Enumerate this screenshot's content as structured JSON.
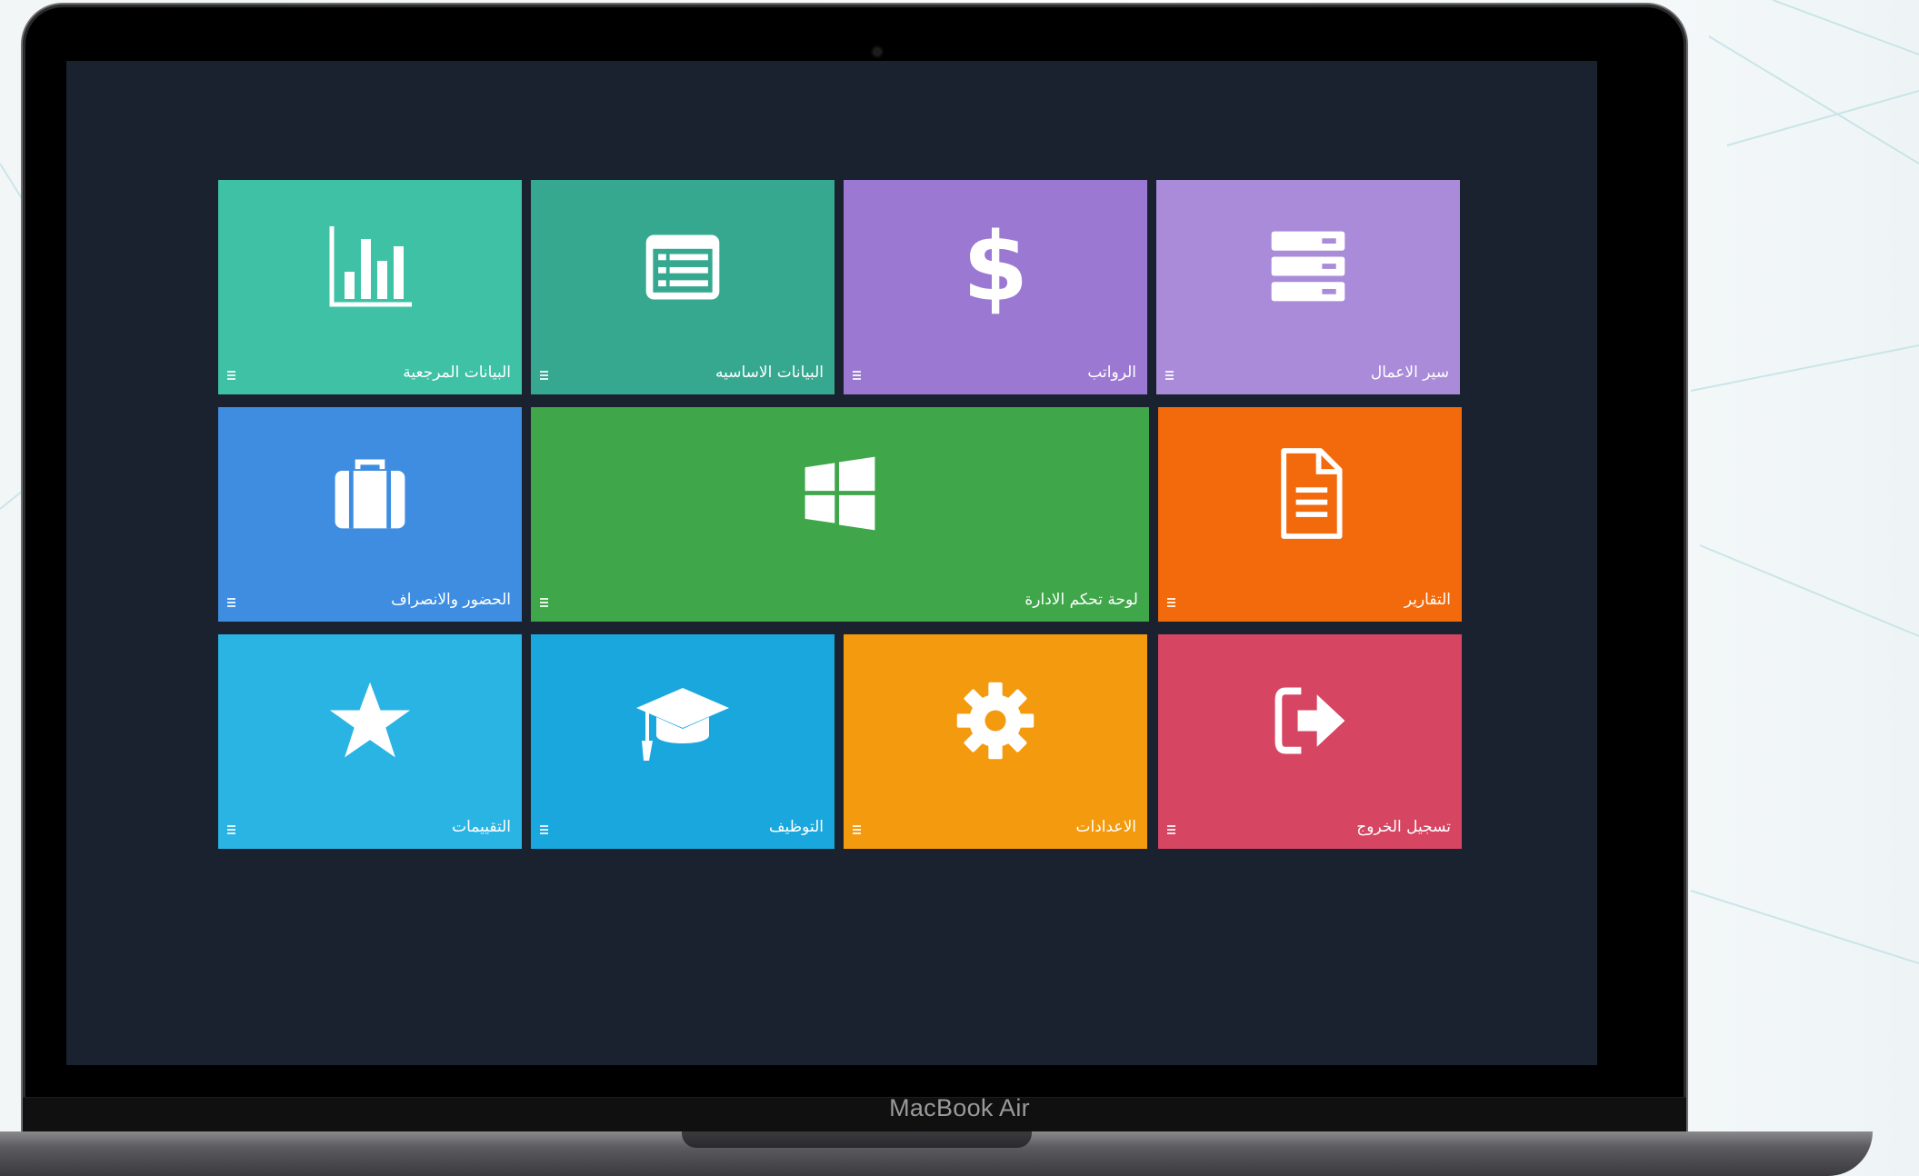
{
  "device": {
    "model_label": "MacBook Air"
  },
  "tiles": [
    {
      "id": "reference-data",
      "label": "البيانات المرجعية",
      "icon": "bar-chart-icon",
      "color": "#3ec1a5"
    },
    {
      "id": "basic-data",
      "label": "البيانات الاساسيه",
      "icon": "list-table-icon",
      "color": "#36a88f"
    },
    {
      "id": "salaries",
      "label": "الرواتب",
      "icon": "dollar-icon",
      "color": "#9b79d2"
    },
    {
      "id": "workflow",
      "label": "سير الاعمال",
      "icon": "server-stack-icon",
      "color": "#a98bd9"
    },
    {
      "id": "attendance",
      "label": "الحضور والانصراف",
      "icon": "briefcase-icon",
      "color": "#3f8de0"
    },
    {
      "id": "admin-dashboard",
      "label": "لوحة تحكم الادارة",
      "icon": "windows-logo-icon",
      "color": "#3fa64a"
    },
    {
      "id": "reports",
      "label": "التقارير",
      "icon": "document-icon",
      "color": "#f36a0c"
    },
    {
      "id": "evaluations",
      "label": "التقييمات",
      "icon": "star-icon",
      "color": "#2ab4e4"
    },
    {
      "id": "employment",
      "label": "التوظيف",
      "icon": "graduation-cap-icon",
      "color": "#1aa7dd"
    },
    {
      "id": "settings",
      "label": "الاعدادات",
      "icon": "gear-icon",
      "color": "#f49a0e"
    },
    {
      "id": "logout",
      "label": "تسجيل الخروج",
      "icon": "sign-out-icon",
      "color": "#d64562"
    }
  ]
}
